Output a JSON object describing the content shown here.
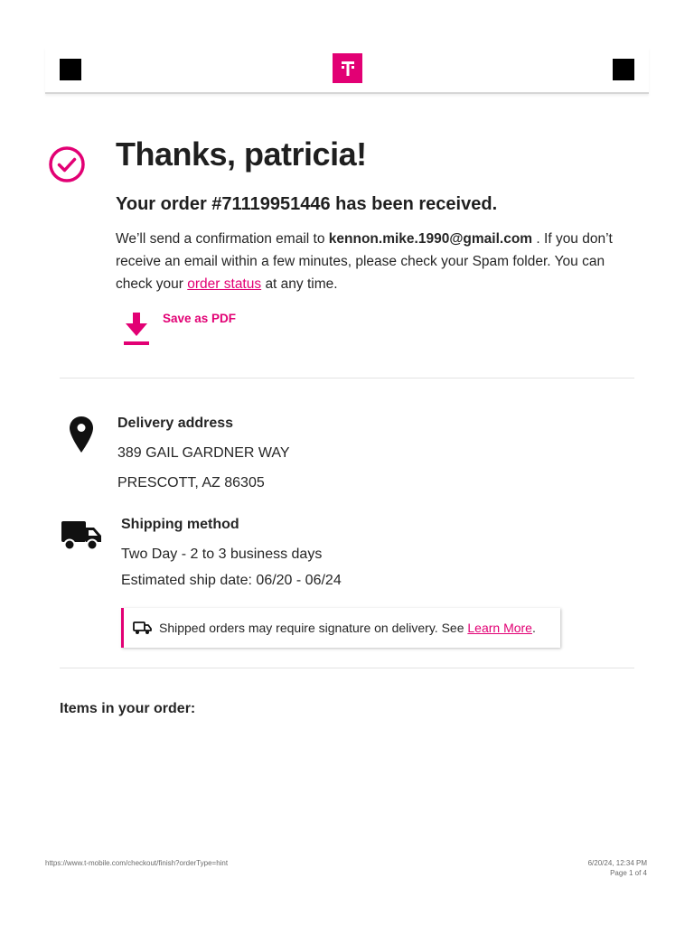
{
  "header": {
    "left_icon": "black-square",
    "right_icon": "black-square",
    "logo_text": "T",
    "brand_color": "#e20074"
  },
  "hero": {
    "icon": "check-circle-icon",
    "title": "Thanks, patricia!",
    "subtitle": "Your order #71119951446 has been received."
  },
  "confirmation": {
    "part1": "We’ll send a confirmation email to",
    "email": "kennon.mike.1990@gmail.com",
    "part2": ". If you don’t receive an email within a few minutes, please check your Spam folder. You can check your",
    "status_link": "order status",
    "part3": "at any time."
  },
  "pdf": {
    "icon": "download-icon",
    "label": "Save as PDF"
  },
  "delivery": {
    "icon": "map-pin-icon",
    "title": "Delivery address",
    "line1": "389 GAIL GARDNER WAY",
    "line2": "PRESCOTT, AZ 86305"
  },
  "shipping": {
    "icon": "truck-icon",
    "title": "Shipping method",
    "method": "Two Day - 2 to 3 business days",
    "estimate": "Estimated ship date: 06/20 - 06/24"
  },
  "notice": {
    "icon": "truck-outline-icon",
    "text": "Shipped orders may require signature on delivery. See",
    "link": "Learn More",
    "suffix": "."
  },
  "items": {
    "title": "Items in your order:"
  },
  "footer": {
    "url": "https://www.t-mobile.com/checkout/finish?orderType=hint",
    "datetime": "6/20/24, 12:34 PM",
    "page": "Page 1 of 4"
  }
}
